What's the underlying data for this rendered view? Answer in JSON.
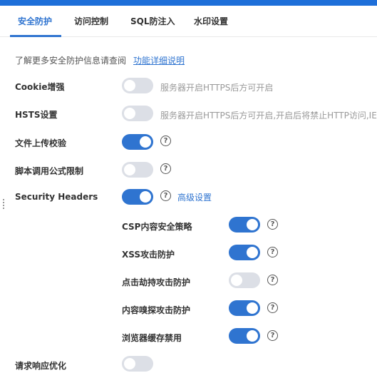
{
  "tabs": [
    {
      "label": "安全防护",
      "active": true
    },
    {
      "label": "访问控制",
      "active": false
    },
    {
      "label": "SQL防注入",
      "active": false
    },
    {
      "label": "水印设置",
      "active": false
    }
  ],
  "info": {
    "text": "了解更多安全防护信息请查阅",
    "link": "功能详细说明"
  },
  "settings": {
    "cookie": {
      "label": "Cookie增强",
      "enabled": false,
      "hint": "服务器开启HTTPS后方可开启"
    },
    "hsts": {
      "label": "HSTS设置",
      "enabled": false,
      "hint": "服务器开启HTTPS后方可开启,开启后将禁止HTTP访问,IE"
    },
    "upload": {
      "label": "文件上传校验",
      "enabled": true
    },
    "formula": {
      "label": "脚本调用公式限制",
      "enabled": false
    },
    "security_headers": {
      "label": "Security Headers",
      "enabled": true,
      "advanced_label": "高级设置"
    },
    "csp": {
      "label": "CSP内容安全策略",
      "enabled": true
    },
    "xss": {
      "label": "XSS攻击防护",
      "enabled": true
    },
    "clickjack": {
      "label": "点击劫持攻击防护",
      "enabled": false
    },
    "sniff": {
      "label": "内容嗅探攻击防护",
      "enabled": true
    },
    "cache": {
      "label": "浏览器缓存禁用",
      "enabled": true
    },
    "response": {
      "label": "请求响应优化",
      "enabled": false
    }
  },
  "icons": {
    "help": "question-circle-icon",
    "help_glyph": "?"
  },
  "colors": {
    "accent": "#2f74d0",
    "toggle_off": "#dcdfe6",
    "hint_text": "#9a9a9a"
  }
}
